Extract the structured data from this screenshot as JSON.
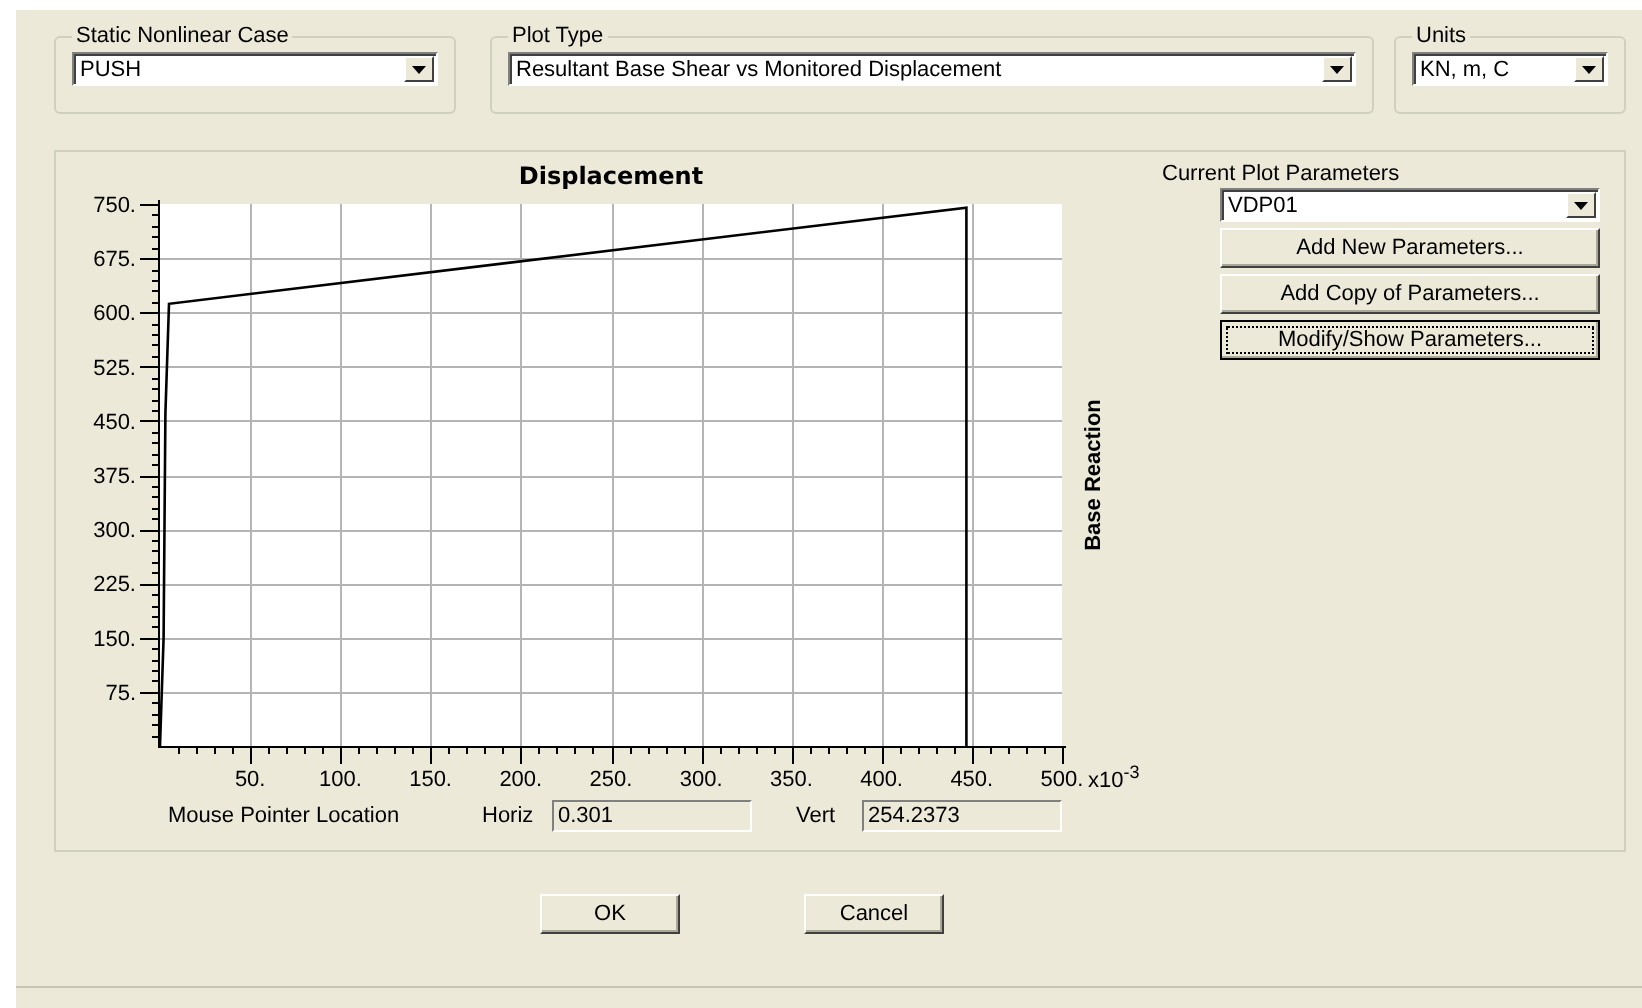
{
  "static_nonlinear_case": {
    "label": "Static Nonlinear Case",
    "value": "PUSH"
  },
  "plot_type": {
    "label": "Plot Type",
    "value": "Resultant Base Shear vs Monitored Displacement"
  },
  "units": {
    "label": "Units",
    "value": "KN, m, C"
  },
  "plot": {
    "axis_multiplier": "x10$^{-3}$",
    "chart_data": {
      "type": "line",
      "grid": true,
      "title": "Displacement",
      "ylabel": "Base Reaction",
      "xlim": [
        0,
        500
      ],
      "ylim": [
        0,
        750
      ],
      "xticks": [
        {
          "value": 50,
          "label": "50."
        },
        {
          "value": 100,
          "label": "100."
        },
        {
          "value": 150,
          "label": "150."
        },
        {
          "value": 200,
          "label": "200."
        },
        {
          "value": 250,
          "label": "250."
        },
        {
          "value": 300,
          "label": "300."
        },
        {
          "value": 350,
          "label": "350."
        },
        {
          "value": 400,
          "label": "400."
        },
        {
          "value": 450,
          "label": "450."
        },
        {
          "value": 500,
          "label": "500."
        }
      ],
      "yticks": [
        {
          "value": 75,
          "label": "75."
        },
        {
          "value": 150,
          "label": "150."
        },
        {
          "value": 225,
          "label": "225."
        },
        {
          "value": 300,
          "label": "300."
        },
        {
          "value": 375,
          "label": "375."
        },
        {
          "value": 450,
          "label": "450."
        },
        {
          "value": 525,
          "label": "525."
        },
        {
          "value": 600,
          "label": "600."
        },
        {
          "value": 675,
          "label": "675."
        },
        {
          "value": 750,
          "label": "750."
        }
      ],
      "x": [
        0,
        2,
        3,
        5,
        447,
        447
      ],
      "series": [
        {
          "color": "#000000",
          "values": [
            0,
            150,
            460,
            612,
            745,
            0
          ]
        }
      ]
    }
  },
  "mouse_pointer": {
    "label": "Mouse Pointer Location",
    "horiz_label": "Horiz",
    "horiz_value": "0.301",
    "vert_label": "Vert",
    "vert_value": "254.2373"
  },
  "current_plot_parameters": {
    "label": "Current Plot Parameters",
    "value": "VDP01",
    "buttons": [
      {
        "label": "Add New Parameters...",
        "focused": false
      },
      {
        "label": "Add Copy of Parameters...",
        "focused": false
      },
      {
        "label": "Modify/Show Parameters...",
        "focused": true
      }
    ]
  },
  "buttons": [
    {
      "label": "OK"
    },
    {
      "label": "Cancel"
    }
  ]
}
